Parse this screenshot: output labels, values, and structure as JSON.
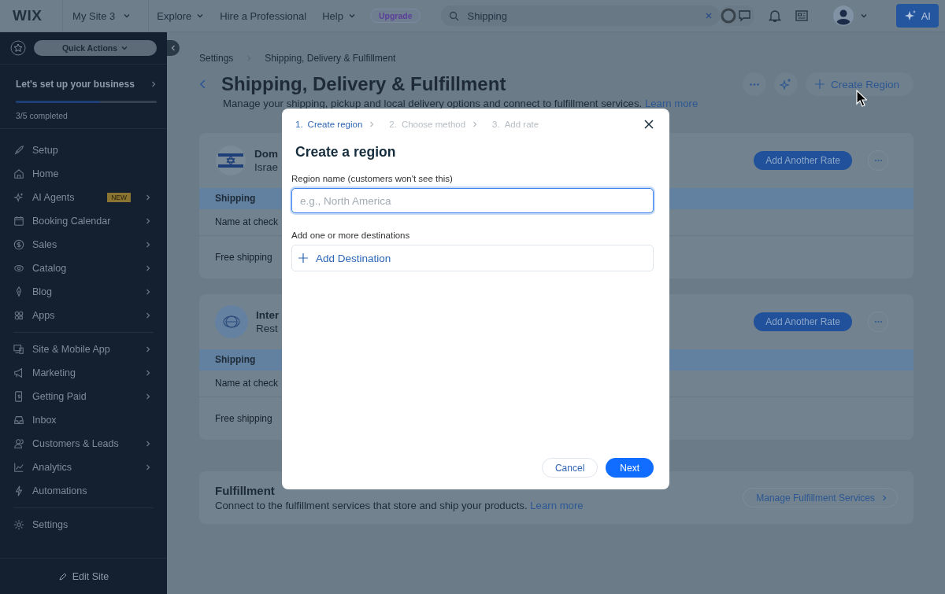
{
  "topbar": {
    "logo": "WIX",
    "site": "My Site 3",
    "nav": [
      {
        "label": "Explore",
        "dropdown": true
      },
      {
        "label": "Hire a Professional",
        "dropdown": false
      },
      {
        "label": "Help",
        "dropdown": true
      }
    ],
    "upgrade": "Upgrade",
    "search": {
      "value": "Shipping"
    },
    "ai": "AI"
  },
  "sidebar": {
    "quick_actions": "Quick Actions",
    "setup": {
      "title": "Let's set up your business",
      "level": 0.6,
      "progress": "3/5 completed"
    },
    "groups": [
      [
        {
          "label": "Setup",
          "has_children": false
        },
        {
          "label": "Home",
          "has_children": false
        },
        {
          "label": "AI Agents",
          "badge": "NEW",
          "has_children": true
        },
        {
          "label": "Booking Calendar",
          "has_children": true
        },
        {
          "label": "Sales",
          "has_children": true
        },
        {
          "label": "Catalog",
          "has_children": true
        },
        {
          "label": "Blog",
          "has_children": true
        },
        {
          "label": "Apps",
          "has_children": true
        }
      ],
      [
        {
          "label": "Site & Mobile App",
          "has_children": true
        },
        {
          "label": "Marketing",
          "has_children": true
        },
        {
          "label": "Getting Paid",
          "has_children": true
        },
        {
          "label": "Inbox",
          "has_children": false
        },
        {
          "label": "Customers & Leads",
          "has_children": true
        },
        {
          "label": "Analytics",
          "has_children": true
        },
        {
          "label": "Automations",
          "has_children": false
        }
      ],
      [
        {
          "label": "Settings",
          "has_children": false
        }
      ]
    ],
    "edit_site": "Edit Site"
  },
  "page": {
    "breadcrumb": [
      "Settings",
      "Shipping, Delivery & Fulfillment"
    ],
    "title": "Shipping, Delivery & Fulfillment",
    "description": "Manage your shipping, pickup and local delivery options and connect to fulfillment services.",
    "learn_more": "Learn more",
    "create_region": "Create Region",
    "regions": [
      {
        "kind": "flag",
        "name": "Dom",
        "subtitle": "Israe",
        "button": "Add Another Rate",
        "header": "Shipping",
        "rows": [
          "Name at check",
          "Free shipping"
        ]
      },
      {
        "kind": "globe",
        "name": "Inter",
        "subtitle": "Rest",
        "button": "Add Another Rate",
        "header": "Shipping",
        "rows": [
          "Name at check",
          "Free shipping"
        ]
      }
    ],
    "fulfillment": {
      "title": "Fulfillment",
      "description": "Connect to the fulfillment services that store and ship your products.",
      "link": "Learn more",
      "button": "Manage Fulfillment Services"
    }
  },
  "modal": {
    "steps": [
      {
        "number": "1.",
        "label": "Create region",
        "selected": true
      },
      {
        "number": "2.",
        "label": "Choose method",
        "selected": false
      },
      {
        "number": "3.",
        "label": "Add rate",
        "selected": false
      }
    ],
    "title": "Create a region",
    "name_label": "Region name (customers won't see this)",
    "name_placeholder": "e.g., North America",
    "destinations_label": "Add one or more destinations",
    "add_destination": "Add Destination",
    "cancel": "Cancel",
    "next": "Next"
  }
}
